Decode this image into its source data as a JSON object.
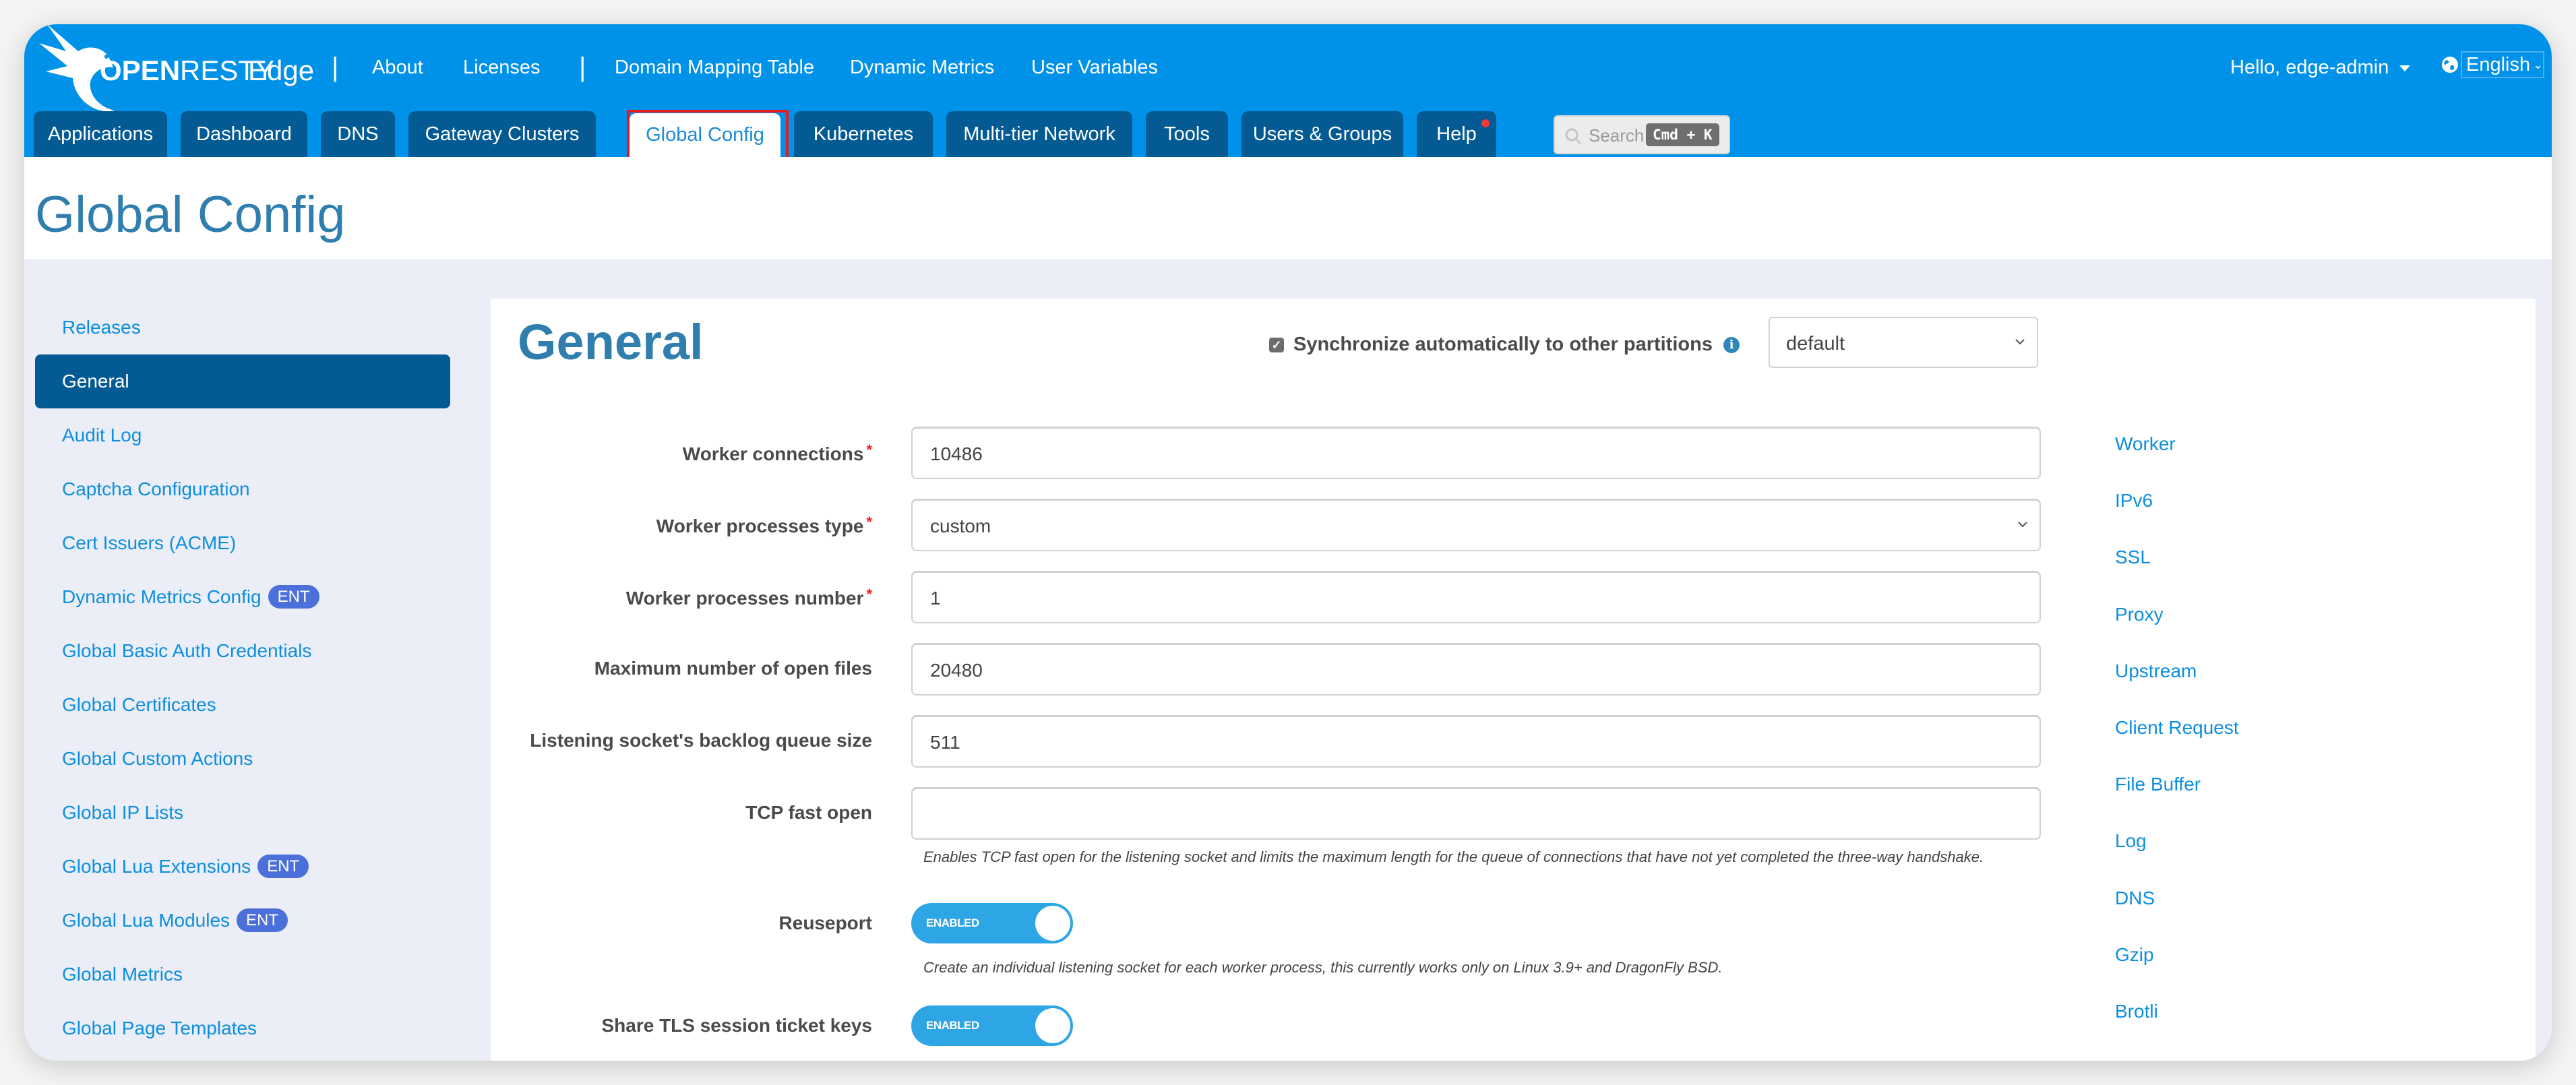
{
  "header": {
    "logo_text_bold": "OPEN",
    "logo_text_light": "RESTY",
    "product": "Edge",
    "nav_links": [
      "About",
      "Licenses",
      "Domain Mapping Table",
      "Dynamic Metrics",
      "User Variables"
    ],
    "user_greeting": "Hello, edge-admin",
    "language": "English"
  },
  "tabs": [
    {
      "label": "Applications"
    },
    {
      "label": "Dashboard"
    },
    {
      "label": "DNS"
    },
    {
      "label": "Gateway Clusters"
    },
    {
      "label": "Global Config",
      "active": true
    },
    {
      "label": "Kubernetes"
    },
    {
      "label": "Multi-tier Network"
    },
    {
      "label": "Tools"
    },
    {
      "label": "Users & Groups"
    },
    {
      "label": "Help",
      "notification": true
    }
  ],
  "search": {
    "placeholder": "Search",
    "shortcut": "Cmd + K"
  },
  "page_title": "Global Config",
  "sidebar": {
    "items": [
      {
        "label": "Releases"
      },
      {
        "label": "General",
        "active": true
      },
      {
        "label": "Audit Log"
      },
      {
        "label": "Captcha Configuration"
      },
      {
        "label": "Cert Issuers (ACME)"
      },
      {
        "label": "Dynamic Metrics Config",
        "badge": "ENT"
      },
      {
        "label": "Global Basic Auth Credentials"
      },
      {
        "label": "Global Certificates"
      },
      {
        "label": "Global Custom Actions"
      },
      {
        "label": "Global IP Lists"
      },
      {
        "label": "Global Lua Extensions",
        "badge": "ENT"
      },
      {
        "label": "Global Lua Modules",
        "badge": "ENT"
      },
      {
        "label": "Global Metrics"
      },
      {
        "label": "Global Page Templates"
      }
    ]
  },
  "main": {
    "section_title": "General",
    "sync_label": "Synchronize automatically to other partitions",
    "sync_checked": true,
    "partition": "default",
    "fields": [
      {
        "label": "Worker connections",
        "required": true,
        "type": "text",
        "value": "10486"
      },
      {
        "label": "Worker processes type",
        "required": true,
        "type": "select",
        "value": "custom"
      },
      {
        "label": "Worker processes number",
        "required": true,
        "type": "text",
        "value": "1"
      },
      {
        "label": "Maximum number of open files",
        "required": false,
        "type": "text",
        "value": "20480"
      },
      {
        "label": "Listening socket's backlog queue size",
        "required": false,
        "type": "text",
        "value": "511"
      },
      {
        "label": "TCP fast open",
        "required": false,
        "type": "text",
        "value": "",
        "help": "Enables TCP fast open for the listening socket and limits the maximum length for the queue of connections that have not yet completed the three-way handshake."
      },
      {
        "label": "Reuseport",
        "required": false,
        "type": "toggle",
        "value": "ENABLED",
        "help": "Create an individual listening socket for each worker process, this currently works only on Linux 3.9+ and DragonFly BSD."
      },
      {
        "label": "Share TLS session ticket keys",
        "required": false,
        "type": "toggle",
        "value": "ENABLED"
      }
    ],
    "required_marker": "*",
    "anchors": [
      "Worker",
      "IPv6",
      "SSL",
      "Proxy",
      "Upstream",
      "Client Request",
      "File Buffer",
      "Log",
      "DNS",
      "Gzip",
      "Brotli"
    ]
  },
  "colors": {
    "header_bg": "#0091e8",
    "tab_bg": "#045b93",
    "title_color": "#2f7eae",
    "link_color": "#0c8ee0",
    "badge_bg": "#4c70d9",
    "toggle_bg": "#2ea5e4",
    "highlight_border": "#e8191f"
  }
}
